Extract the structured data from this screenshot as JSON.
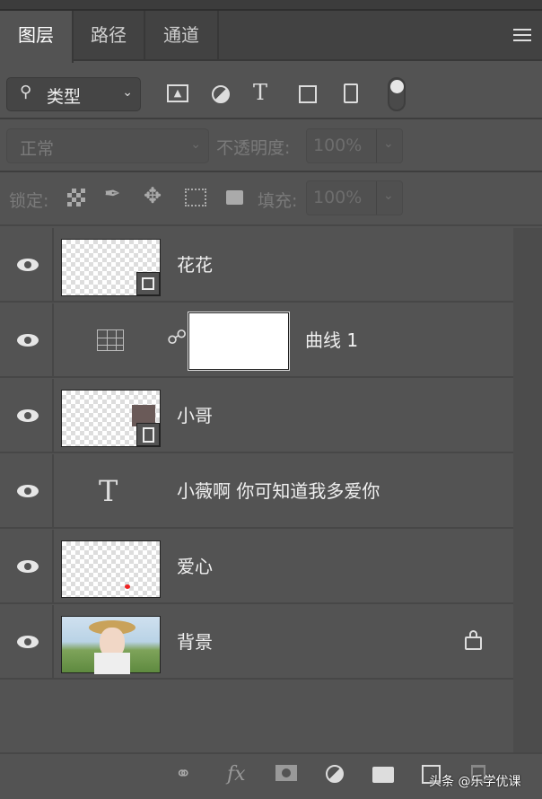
{
  "tabs": [
    {
      "label": "图层"
    },
    {
      "label": "路径"
    },
    {
      "label": "通道"
    }
  ],
  "filter": {
    "kind_label": "类型"
  },
  "blend": {
    "mode": "正常",
    "opacity_label": "不透明度:",
    "opacity": "100%"
  },
  "lock": {
    "label": "锁定:",
    "fill_label": "填充:",
    "fill": "100%"
  },
  "layers": [
    {
      "name": "花花",
      "type": "smart-object"
    },
    {
      "name": "曲线 1",
      "type": "curves-adjustment"
    },
    {
      "name": "小哥",
      "type": "smart-object"
    },
    {
      "name": "小薇啊 你可知道我多爱你",
      "type": "text"
    },
    {
      "name": "爱心",
      "type": "pixel"
    },
    {
      "name": "背景",
      "type": "background",
      "locked": true
    }
  ],
  "watermark": "头条 @乐学优课"
}
